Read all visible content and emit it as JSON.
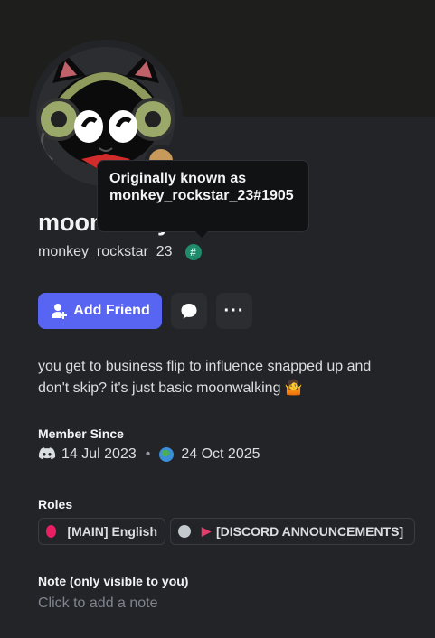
{
  "profile": {
    "display_name": "moonwalky",
    "username": "monkey_rockstar_23",
    "badge_glyph": "#",
    "tooltip": {
      "line1": "Originally known as",
      "line2": "monkey_rockstar_23#1905"
    }
  },
  "actions": {
    "add_friend_label": "Add Friend",
    "message_icon": "chat-bubble-icon",
    "more_label": "···"
  },
  "bio": "you get to business flip to influence snapped up and don't skip? it's just basic moonwalking 🤷",
  "member_since": {
    "title": "Member Since",
    "discord_date": "14 Jul 2023",
    "separator": "•",
    "server_date": "24 Oct 2025"
  },
  "roles": {
    "title": "Roles",
    "items": [
      {
        "label": "[MAIN] English",
        "color": "#e91e63"
      },
      {
        "label": "[DISCORD ANNOUNCEMENTS]",
        "color": "#c4c9ce"
      }
    ]
  },
  "note": {
    "title": "Note (only visible to you)",
    "placeholder": "Click to add a note"
  },
  "colors": {
    "accent": "#5865f2",
    "background": "#232428",
    "banner": "#1e1f1c"
  }
}
